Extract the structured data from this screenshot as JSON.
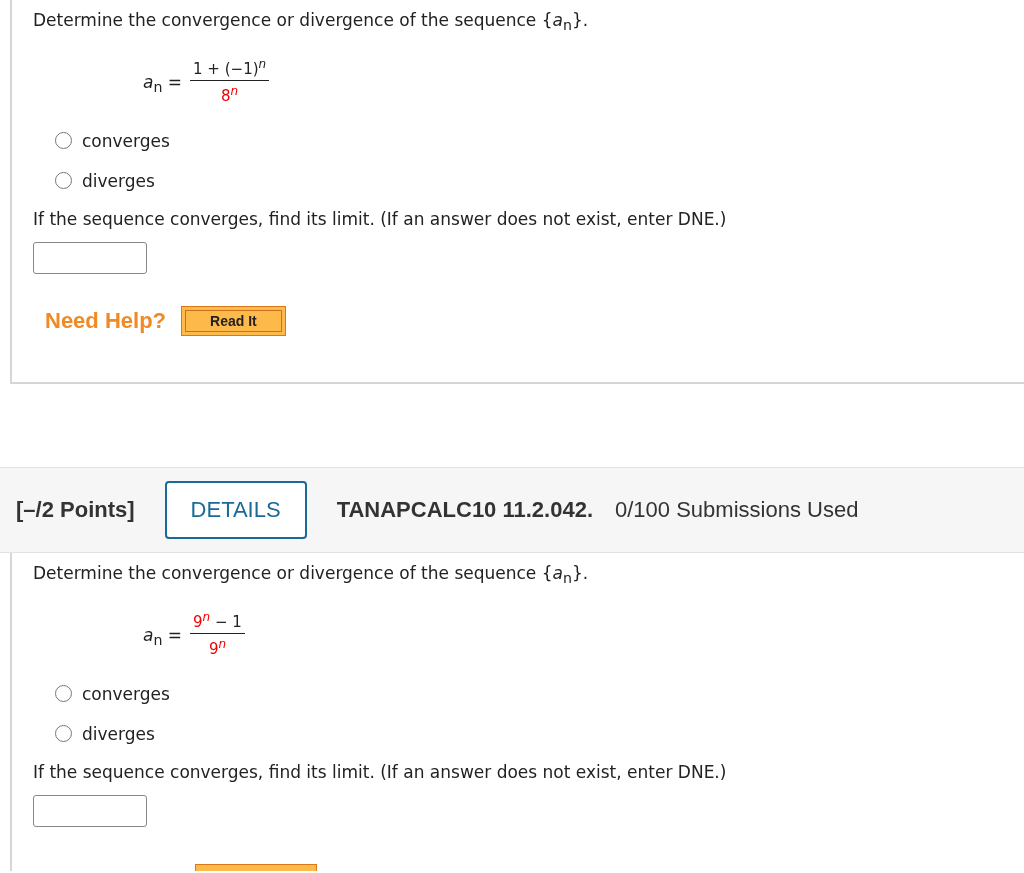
{
  "problems": [
    {
      "question": "Determine the convergence or divergence of the sequence {*a*$_{n}$}.",
      "formula": {
        "lhs": "*a*$_{n}$ =",
        "numerator": [
          {
            "base": "1 + (−1)",
            "sup": "n",
            "highlighted": false
          }
        ],
        "denominator": [
          {
            "base": "8",
            "sup": "n",
            "highlighted": true
          }
        ]
      },
      "options": [
        {
          "label": "converges",
          "selected": false
        },
        {
          "label": "diverges",
          "selected": false
        }
      ],
      "prompt": "If the sequence converges, find its limit. (If an answer does not exist, enter DNE.)",
      "help": {
        "label": "Need Help?",
        "button": "Read It"
      }
    },
    {
      "header": {
        "points": "[–/2 Points]",
        "details": "DETAILS",
        "code": "TANAPCALC10 11.2.042.",
        "submissions": "0/100 Submissions Used"
      },
      "question": "Determine the convergence or divergence of the sequence {*a*$_{n}$}.",
      "formula": {
        "lhs": "*a*$_{n}$ =",
        "numerator": [
          {
            "base": "9",
            "sup": "n",
            "highlighted": true
          },
          {
            "base": " − 1",
            "highlighted": false
          }
        ],
        "denominator": [
          {
            "base": "9",
            "sup": "n",
            "highlighted": true
          }
        ]
      },
      "options": [
        {
          "label": "converges",
          "selected": false
        },
        {
          "label": "diverges",
          "selected": false
        }
      ],
      "prompt": "If the sequence converges, find its limit. (If an answer does not exist, enter DNE.)"
    }
  ]
}
